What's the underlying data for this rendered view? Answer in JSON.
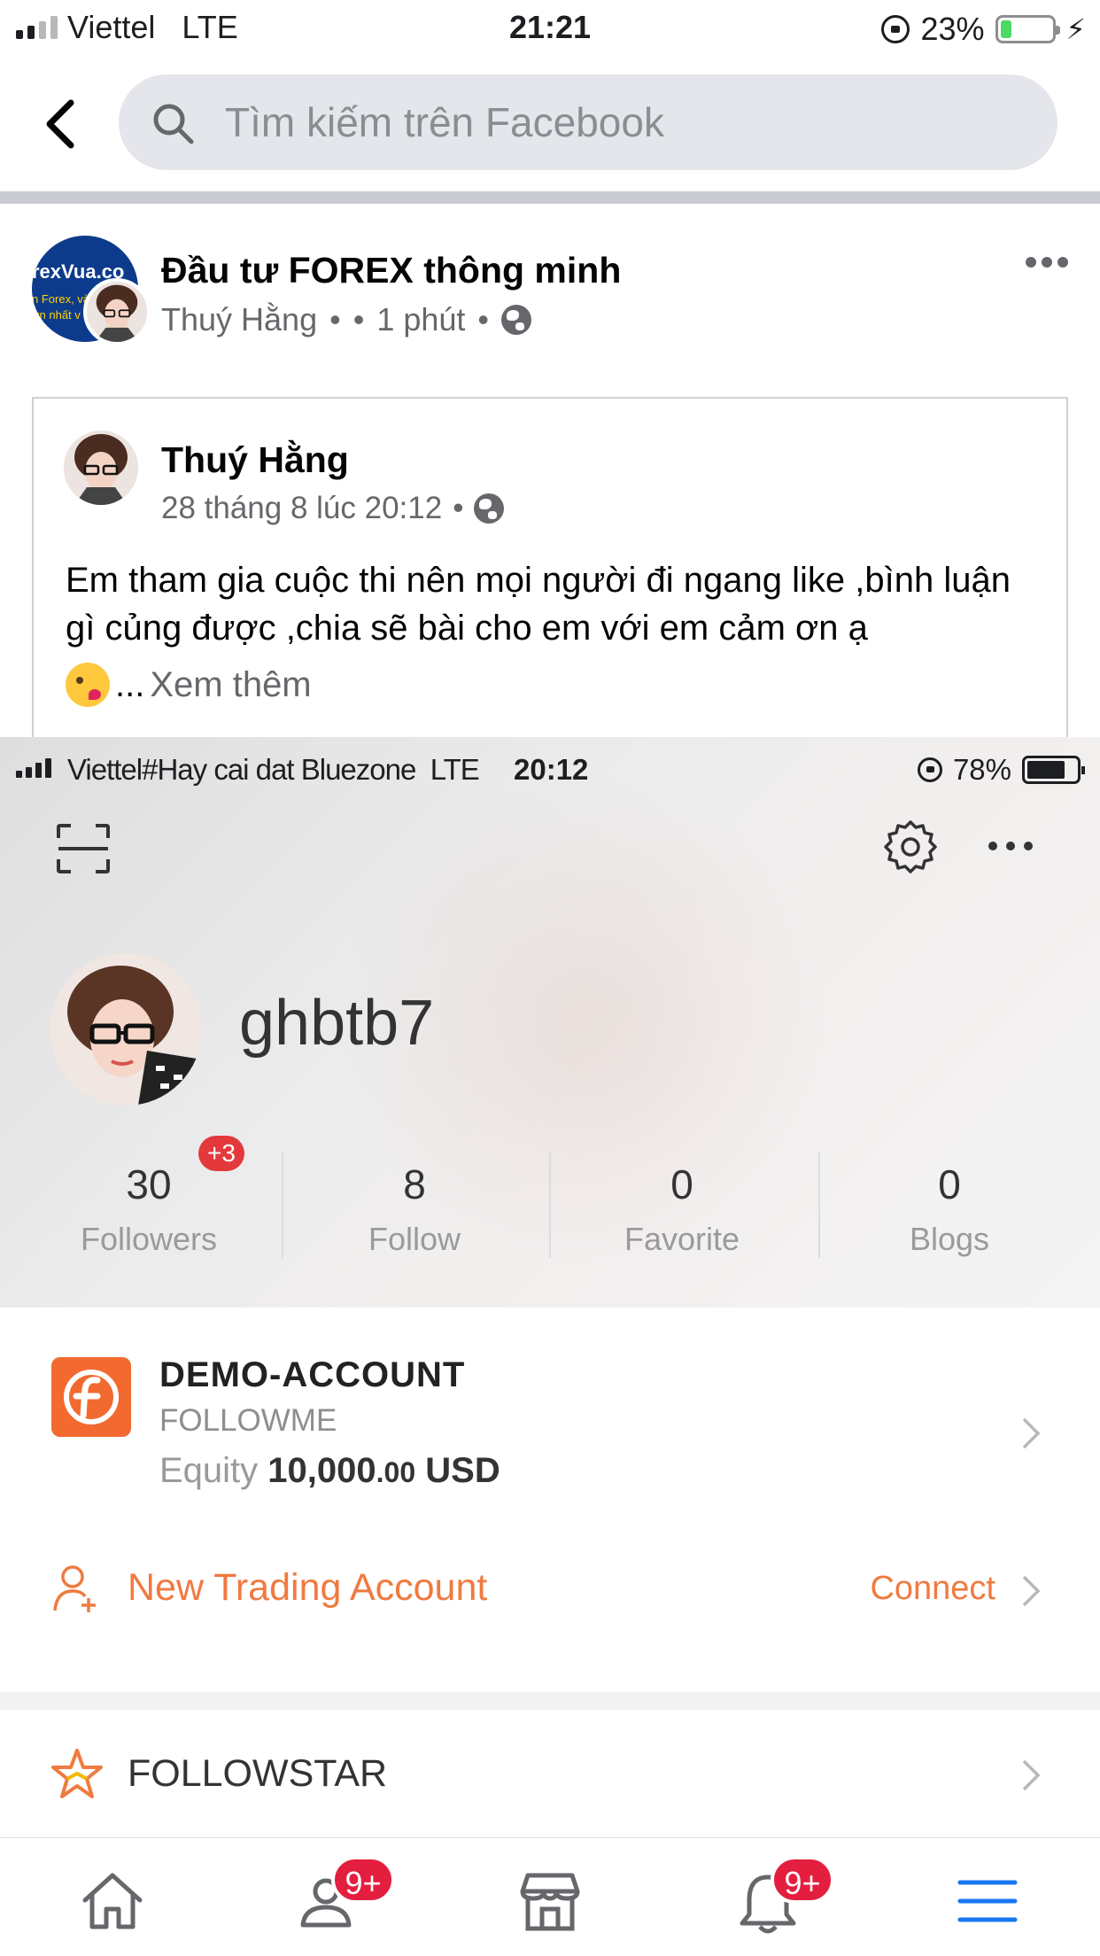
{
  "status_bar": {
    "carrier": "Viettel",
    "network": "LTE",
    "time": "21:21",
    "battery": "23%",
    "battery_level": 0.23
  },
  "search": {
    "placeholder": "Tìm kiếm trên Facebook"
  },
  "post": {
    "group_name": "Đầu tư FOREX thông minh",
    "group_avatar_text": [
      "rexVua.co",
      "n Forex, và",
      "ơn nhất v"
    ],
    "author": "Thuý Hằng",
    "time": "1 phút",
    "meta_separator": "•"
  },
  "shared_post": {
    "author": "Thuý Hằng",
    "date": "28 tháng 8 lúc 20:12",
    "text": "Em tham gia cuộc thi nên mọi người đi ngang like ,bình luận gì củng được ,chia sẽ bài cho em với em cảm ơn ạ",
    "ellipsis": "...",
    "see_more": "Xem thêm"
  },
  "embedded_app": {
    "status_bar": {
      "carrier": "Viettel#Hay cai dat Bluezone",
      "network": "LTE",
      "time": "20:12",
      "battery": "78%",
      "battery_level": 0.78
    },
    "username": "ghbtb7",
    "stats": [
      {
        "value": "30",
        "label": "Followers",
        "badge": "+3"
      },
      {
        "value": "8",
        "label": "Follow"
      },
      {
        "value": "0",
        "label": "Favorite"
      },
      {
        "value": "0",
        "label": "Blogs"
      }
    ],
    "account": {
      "title": "DEMO-ACCOUNT",
      "subtitle": "FOLLOWME",
      "equity_label": "Equity",
      "equity_value": "10,000",
      "equity_decimals": ".00",
      "equity_currency": "USD"
    },
    "new_account": {
      "label": "New Trading Account",
      "action": "Connect"
    },
    "followstar": {
      "label": "FOLLOWSTAR"
    },
    "accent_color": "#f07a40"
  },
  "tab_bar": {
    "tabs": [
      {
        "name": "home",
        "icon": "home-icon"
      },
      {
        "name": "friends",
        "icon": "friends-icon",
        "badge": "9+"
      },
      {
        "name": "marketplace",
        "icon": "marketplace-icon"
      },
      {
        "name": "notifications",
        "icon": "bell-icon",
        "badge": "9+"
      },
      {
        "name": "menu",
        "icon": "menu-icon",
        "active": true
      }
    ],
    "badge_color": "#e41e3f",
    "active_color": "#1877f2"
  }
}
